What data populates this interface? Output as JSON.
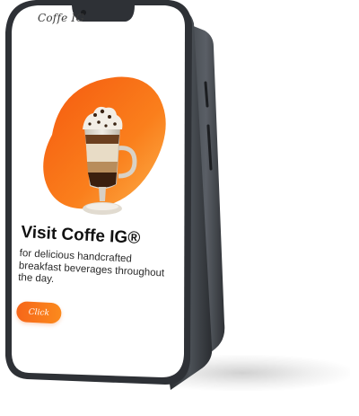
{
  "app": {
    "logo_text": "Coffe IG"
  },
  "hero": {
    "headline": "Visit Coffe IG®",
    "tagline": "for delicious handcrafted breakfast beverages throughout the day.",
    "cta_label": "Click"
  },
  "icons": [
    "coffee-glass-image",
    "orange-blob-icon"
  ],
  "colors": {
    "accent": "#f96c1b",
    "accent_light": "#fb9a2a",
    "phone_frame": "#2b2e33",
    "text": "#111111"
  }
}
